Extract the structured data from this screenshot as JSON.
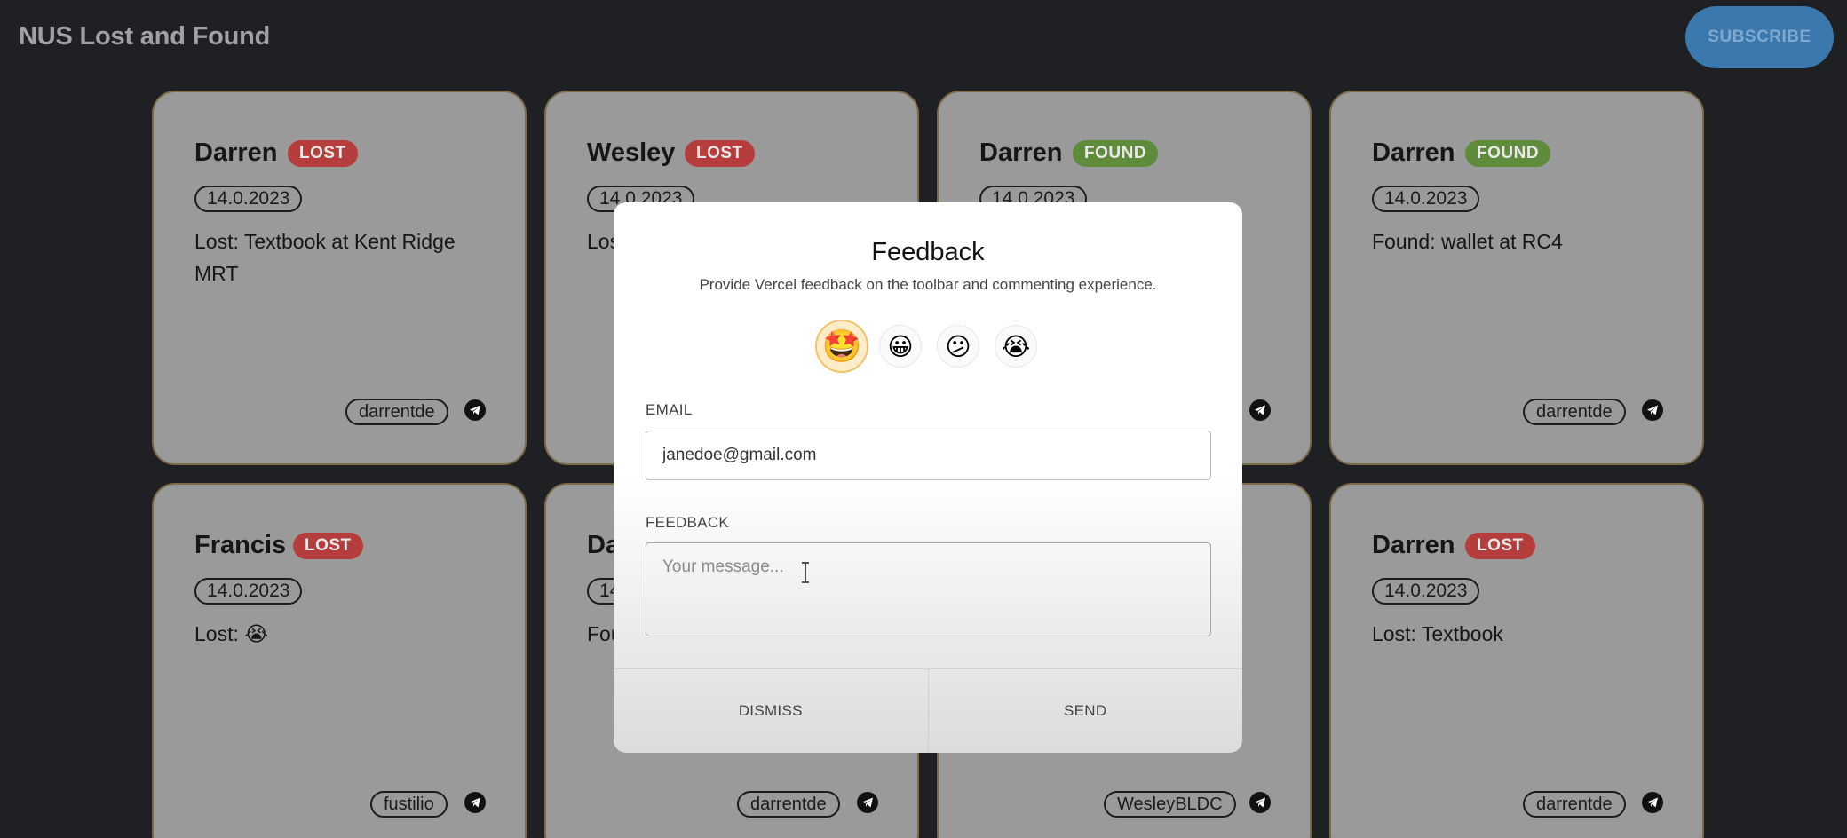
{
  "header": {
    "title": "NUS Lost and Found",
    "subscribe_label": "SUBSCRIBE"
  },
  "cards": [
    {
      "name": "Darren",
      "status": "LOST",
      "date": "14.0.2023",
      "description": "Lost: Textbook at Kent Ridge MRT",
      "user": "darrentde"
    },
    {
      "name": "Wesley",
      "status": "LOST",
      "date": "14.0.2023",
      "description": "Los",
      "user": ""
    },
    {
      "name": "Darren",
      "status": "FOUND",
      "date": "14.0.2023",
      "description": "",
      "user": ""
    },
    {
      "name": "Darren",
      "status": "FOUND",
      "date": "14.0.2023",
      "description": "Found: wallet at RC4",
      "user": "darrentde"
    },
    {
      "name": "Francis",
      "status": "LOST",
      "date": "14.0.2023",
      "description": "Lost: 😭",
      "user": "fustilio"
    },
    {
      "name": "Da",
      "status": "",
      "date": "14",
      "description": "Fou",
      "user": "darrentde"
    },
    {
      "name": "",
      "status": "",
      "date": "",
      "description": "",
      "user": "WesleyBLDC"
    },
    {
      "name": "Darren",
      "status": "LOST",
      "date": "14.0.2023",
      "description": "Lost: Textbook",
      "user": "darrentde"
    }
  ],
  "modal": {
    "title": "Feedback",
    "subtitle": "Provide Vercel feedback on the toolbar and commenting experience.",
    "emojis": [
      "🤩",
      "😀",
      "😕",
      "😭"
    ],
    "selected_emoji_index": 0,
    "email_label": "EMAIL",
    "email_value": "janedoe@gmail.com",
    "feedback_label": "FEEDBACK",
    "feedback_placeholder": "Your message...",
    "dismiss_label": "DISMISS",
    "send_label": "SEND"
  },
  "colors": {
    "background": "#1f2023",
    "card": "#9a9a9b",
    "lost_badge": "#b53e3c",
    "found_badge": "#5e8c3b",
    "subscribe": "#3a78ad"
  }
}
